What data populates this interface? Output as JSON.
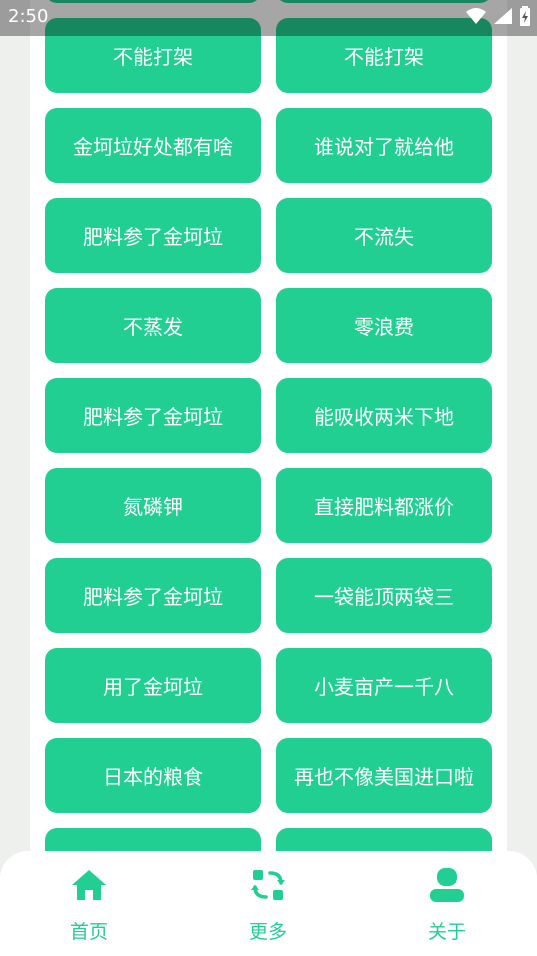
{
  "status_bar": {
    "time": "2:50"
  },
  "grid": [
    [
      "",
      ""
    ],
    [
      "不能打架",
      "不能打架"
    ],
    [
      "金坷垃好处都有啥",
      "谁说对了就给他"
    ],
    [
      "肥料参了金坷垃",
      "不流失"
    ],
    [
      "不蒸发",
      "零浪费"
    ],
    [
      "肥料参了金坷垃",
      "能吸收两米下地"
    ],
    [
      "氮磷钾",
      "直接肥料都涨价"
    ],
    [
      "肥料参了金坷垃",
      "一袋能顶两袋三"
    ],
    [
      "用了金坷垃",
      "小麦亩产一千八"
    ],
    [
      "日本的粮食",
      "再也不像美国进口啦"
    ],
    [
      "",
      ""
    ]
  ],
  "tab_bar": {
    "tabs": [
      {
        "label": "首页",
        "icon": "home-icon"
      },
      {
        "label": "更多",
        "icon": "refresh-icon"
      },
      {
        "label": "关于",
        "icon": "person-icon"
      }
    ],
    "accent": "#22cf92"
  },
  "colors": {
    "button": "#22cf92",
    "background": "#eef0ee",
    "panel": "#ffffff"
  }
}
